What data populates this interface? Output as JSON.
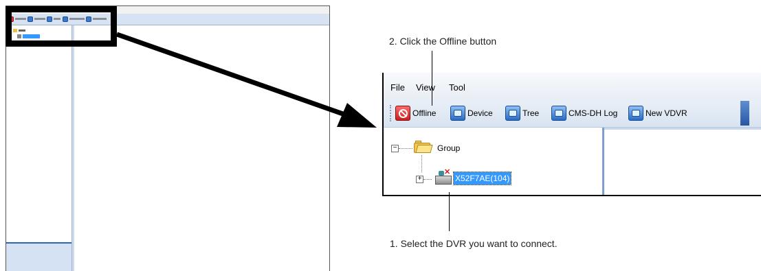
{
  "menu": {
    "file": "File",
    "view": "View",
    "tool": "Tool"
  },
  "toolbar": {
    "buttons": [
      {
        "label": "Offline",
        "icon": "offline-icon"
      },
      {
        "label": "Device",
        "icon": "device-icon"
      },
      {
        "label": "Tree",
        "icon": "tree-icon"
      },
      {
        "label": "CMS-DH Log",
        "icon": "log-icon"
      },
      {
        "label": "New VDVR",
        "icon": "new-vdvr-icon"
      }
    ]
  },
  "tree": {
    "group": {
      "label": "Group",
      "expander": "−"
    },
    "dvr": {
      "label": "X52F7AE(104)",
      "expander": "+"
    }
  },
  "callouts": {
    "step2": "2. Click the Offline button",
    "step1": "1. Select the DVR you want to connect."
  },
  "colors": {
    "selection": "#3399ff",
    "toolbar": "#d9e4f1",
    "offline": "#d33"
  }
}
